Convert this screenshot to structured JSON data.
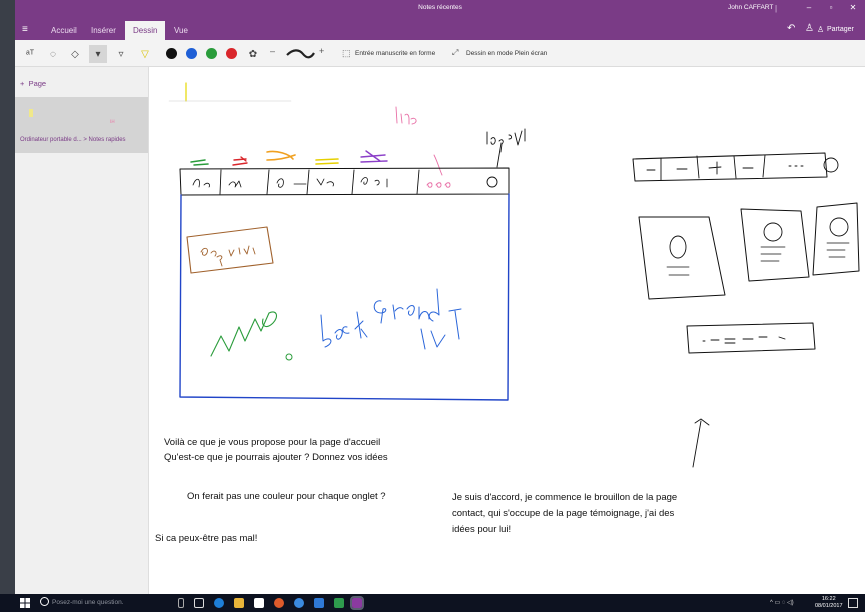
{
  "window": {
    "title": "Notes récentes",
    "user": "John CAFFART",
    "separator": "|",
    "minimize": "–",
    "restore": "▫",
    "close": "✕"
  },
  "ribbon": {
    "tabs": [
      {
        "label": "Accueil"
      },
      {
        "label": "Insérer"
      },
      {
        "label": "Dessin",
        "active": true
      },
      {
        "label": "Vue"
      }
    ],
    "share_label": "Partager"
  },
  "toolbar": {
    "colors": [
      "#111111",
      "#1f5fd6",
      "#2a9c3b",
      "#d9262b"
    ],
    "minus": "–",
    "plus": "+",
    "ink_to_shape_label": "Entrée manuscrite en forme",
    "fullscreen_label": "Dessin en mode Plein écran"
  },
  "left_pane": {
    "add_page_label": "Page",
    "page_breadcrumb": "Ordinateur portable d... > Notes rapides"
  },
  "notes": {
    "line1": "Voilà ce que je vous propose pour la page d'accueil",
    "line2": "Qu'est-ce que je pourrais ajouter ? Donnez vos idées",
    "line3": "On ferait pas une couleur pour chaque onglet ?",
    "line4": "Si ca peux-être pas mal!",
    "line5a": "Je suis d'accord, je commence le brouillon de la page",
    "line5b": "contact, qui s'occupe de la page témoignage, j'ai des",
    "line5c": "idées pour lui!"
  },
  "taskbar": {
    "search_placeholder": "Posez-moi une question.",
    "time": "16:22",
    "date": "08/01/2017"
  }
}
